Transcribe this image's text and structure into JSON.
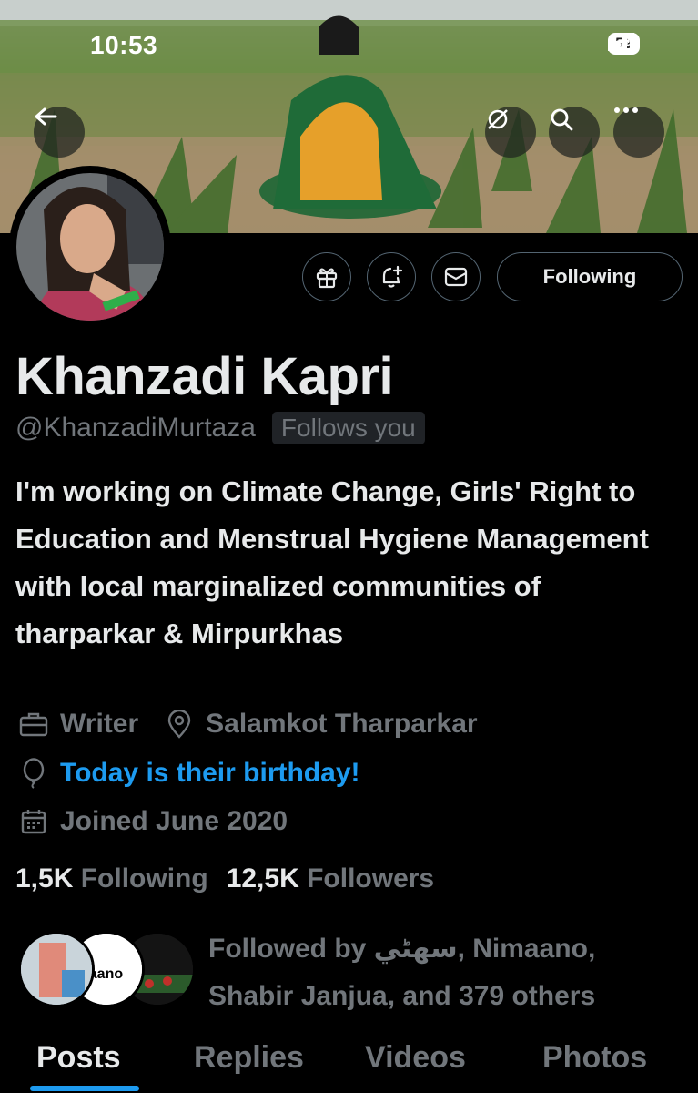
{
  "status_bar": {
    "time": "10:53",
    "battery": "59"
  },
  "header": {
    "back_icon": "arrow-left-icon",
    "actions": [
      "no-notifications-icon",
      "search-icon",
      "more-icon"
    ]
  },
  "profile": {
    "name": "Khanzadi Kapri",
    "handle": "@KhanzadiMurtaza",
    "follows_you": "Follows you",
    "bio": "I'm working on Climate Change, Girls' Right to Education and Menstrual Hygiene Management with local marginalized communities of tharparkar & Mirpurkhas",
    "profession": "Writer",
    "location": "Salamkot Tharparkar",
    "birthday": "Today is their birthday!",
    "joined": "Joined June 2020",
    "following_count": "1,5K",
    "following_label": "Following",
    "followers_count": "12,5K",
    "followers_label": "Followers",
    "followed_by": "Followed by سھڻي, Nimaano, Shabir Janjua, and 379 others"
  },
  "actions": {
    "gift_icon": "gift-icon",
    "notify_icon": "bell-plus-icon",
    "message_icon": "envelope-icon",
    "following_button": "Following"
  },
  "tabs": [
    "Posts",
    "Replies",
    "Videos",
    "Photos"
  ],
  "colors": {
    "accent": "#1d9bf0",
    "background": "#000000",
    "muted": "#71767b",
    "text": "#e7e9ea"
  }
}
